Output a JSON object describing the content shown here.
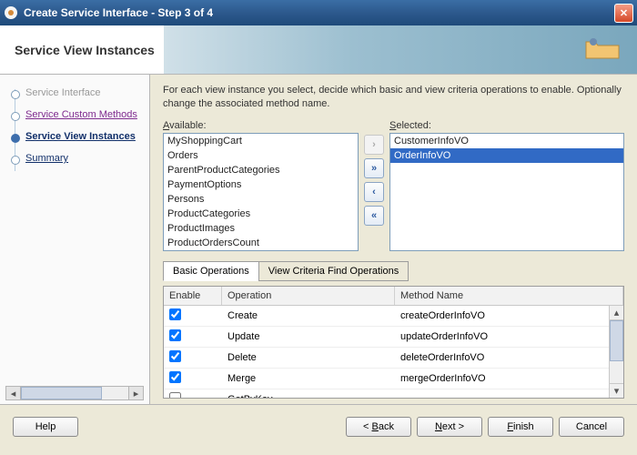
{
  "window": {
    "title": "Create Service Interface - Step 3 of 4"
  },
  "page_title": "Service View Instances",
  "nav": {
    "items": [
      {
        "label": "Service Interface",
        "state": "done"
      },
      {
        "label": "Service Custom Methods",
        "state": "visited"
      },
      {
        "label": "Service View Instances",
        "state": "current"
      },
      {
        "label": "Summary",
        "state": "next"
      }
    ]
  },
  "intro": "For each view instance you select, decide which basic and view criteria operations to enable. Optionally change the associated method name.",
  "available": {
    "label_pre": "A",
    "label_rest": "vailable:",
    "items": [
      "MyShoppingCart",
      "Orders",
      "ParentProductCategories",
      "PaymentOptions",
      "Persons",
      "ProductCategories",
      "ProductImages",
      "ProductOrdersCount"
    ]
  },
  "selected": {
    "label_pre": "S",
    "label_rest": "elected:",
    "items": [
      "CustomerInfoVO",
      "OrderInfoVO"
    ],
    "highlighted_index": 1
  },
  "tabs": {
    "basic": "Basic Operations",
    "criteria": "View Criteria Find Operations"
  },
  "grid": {
    "headers": {
      "enable": "Enable",
      "operation": "Operation",
      "method": "Method Name"
    },
    "rows": [
      {
        "enabled": true,
        "op": "Create",
        "method": "createOrderInfoVO"
      },
      {
        "enabled": true,
        "op": "Update",
        "method": "updateOrderInfoVO"
      },
      {
        "enabled": true,
        "op": "Delete",
        "method": "deleteOrderInfoVO"
      },
      {
        "enabled": true,
        "op": "Merge",
        "method": "mergeOrderInfoVO"
      },
      {
        "enabled": false,
        "op": "GetByKey",
        "method": ""
      }
    ]
  },
  "buttons": {
    "help": "Help",
    "back_pre": "< ",
    "back_u": "B",
    "back_rest": "ack",
    "next_u": "N",
    "next_rest": "ext",
    "next_post": " >",
    "finish_u": "F",
    "finish_rest": "inish",
    "cancel": "Cancel"
  }
}
